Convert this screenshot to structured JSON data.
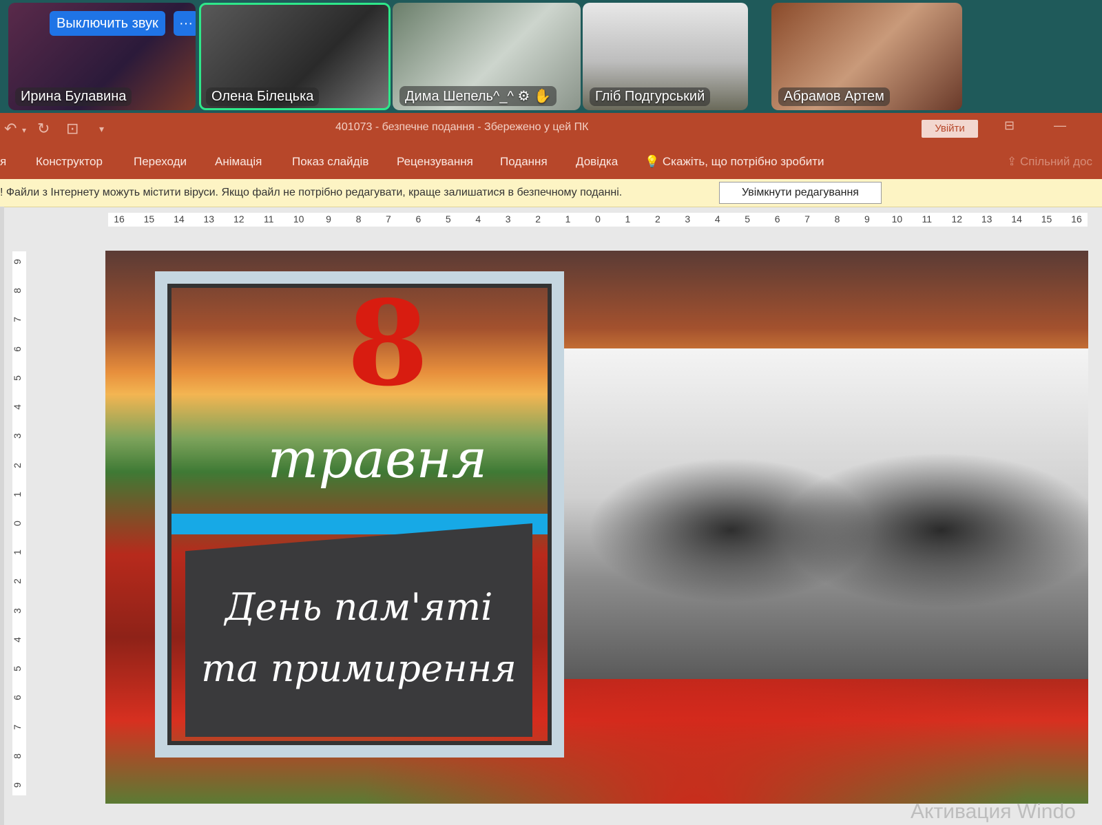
{
  "participants": [
    {
      "name": "Ирина Булавина"
    },
    {
      "name": "Олена Білецька"
    },
    {
      "name": "Дима Шепель^_^"
    },
    {
      "name": "Гліб Подгурський"
    },
    {
      "name": "Абрамов Артем"
    }
  ],
  "tile_controls": {
    "mute_label": "Выключить звук",
    "more_label": "···"
  },
  "titlebar": {
    "title": "401073  -  безпечне подання  -  Збережено у цей ПК",
    "signin_label": "Увійти"
  },
  "ribbon": {
    "tabs": [
      "я",
      "Конструктор",
      "Переходи",
      "Анімація",
      "Показ слайдів",
      "Рецензування",
      "Подання",
      "Довідка"
    ],
    "tell_me": "Скажіть, що потрібно зробити",
    "share": "Спільний дос"
  },
  "security_bar": {
    "message": "! Файли з Інтернету можуть містити віруси. Якщо файл не потрібно редагувати, краще залишатися в безпечному поданні.",
    "enable_editing_label": "Увімкнути редагування"
  },
  "ruler": {
    "horizontal": [
      "16",
      "15",
      "14",
      "13",
      "12",
      "11",
      "10",
      "9",
      "8",
      "7",
      "6",
      "5",
      "4",
      "3",
      "2",
      "1",
      "0",
      "1",
      "2",
      "3",
      "4",
      "5",
      "6",
      "7",
      "8",
      "9",
      "10",
      "11",
      "12",
      "13",
      "14",
      "15",
      "16"
    ],
    "vertical": [
      "9",
      "8",
      "7",
      "6",
      "5",
      "4",
      "3",
      "2",
      "1",
      "0",
      "1",
      "2",
      "3",
      "4",
      "5",
      "6",
      "7",
      "8",
      "9"
    ]
  },
  "slide": {
    "number": "8",
    "month": "травня",
    "line1": "День пам'яті",
    "line2": "та примирення"
  },
  "watermark": "Активация Windo"
}
